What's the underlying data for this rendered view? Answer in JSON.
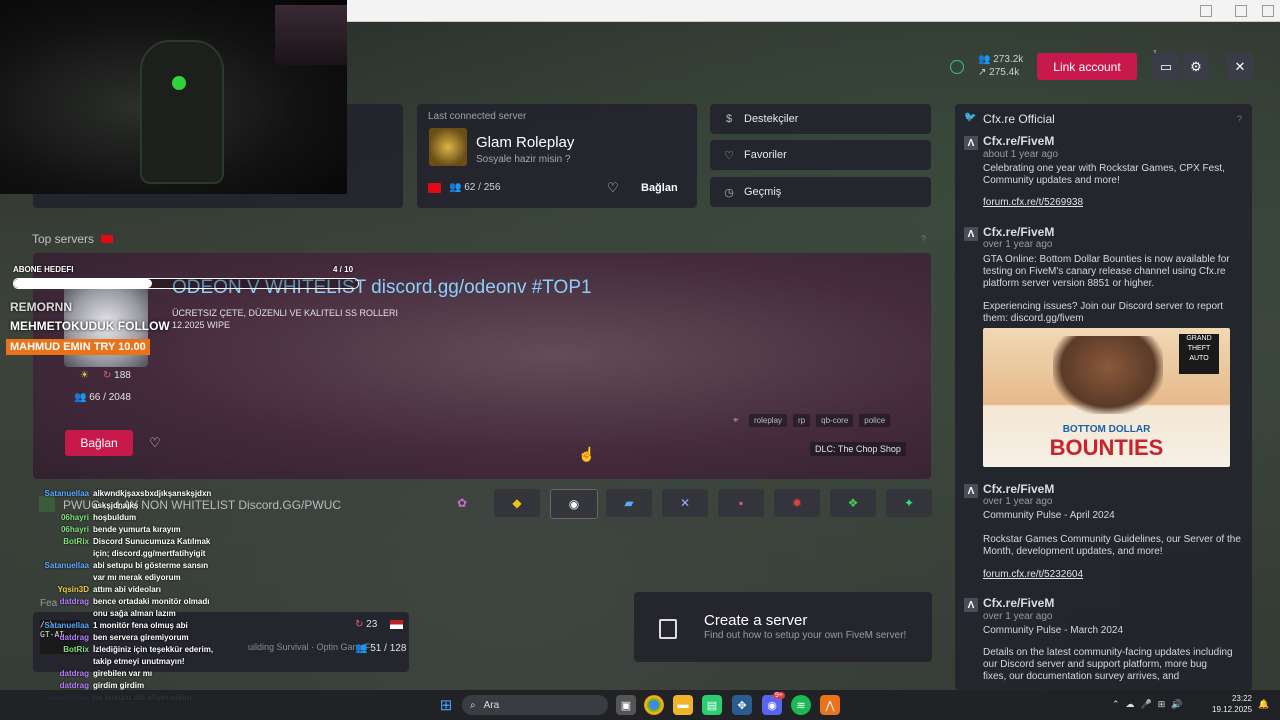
{
  "header": {
    "players_now": "273.2k",
    "players_peak": "275.4k",
    "link_account": "Link account",
    "badge_count": "1"
  },
  "last_server": {
    "heading": "Last connected server",
    "name": "Glam Roleplay",
    "desc": "Sosyale hazir misin ?",
    "players": "62 / 256",
    "connect": "Bağlan"
  },
  "side_menu": {
    "items": [
      {
        "icon": "$",
        "label": "Destekçiler"
      },
      {
        "icon": "♡",
        "label": "Favoriler"
      },
      {
        "icon": "◷",
        "label": "Geçmiş"
      }
    ]
  },
  "top_servers": {
    "label": "Top servers",
    "question": "?"
  },
  "featured": {
    "title": "ODEON V WHITELIST discord.gg/odeonv #TOP1",
    "line1": "ÜCRETSIZ ÇETE, DÜZENLI VE KALITELI SS ROLLERI",
    "line2": "12.2025 WIPE",
    "boosts": "188",
    "players": "66 / 2048",
    "connect": "Bağlan",
    "tags": [
      "roleplay",
      "rp",
      "qb-core",
      "police"
    ],
    "dlc": "DLC: The Chop Shop"
  },
  "overlay": {
    "goal_label": "ABONE HEDEFI",
    "goal_progress": "4 / 10",
    "goal_fraction": 0.4,
    "name1": "REMORNN",
    "name2": "MEHMETOKUDUK FOLLOW",
    "donation": "MAHMUD EMIN  TRY 10.00"
  },
  "server_row2": {
    "text": "PWUC ... LAY NON WHITELIST Discord.GG/PWUC"
  },
  "featured_section": {
    "label": "Fea",
    "server_text": "uilding Survival · Optin Gang F",
    "boosts": "23",
    "players": "51 / 128"
  },
  "create_server": {
    "title": "Create a server",
    "subtitle": "Find out how to setup your own FiveM server!"
  },
  "news": {
    "title": "Cfx.re Official",
    "question": "?",
    "posts": [
      {
        "author": "Cfx.re/FiveM",
        "time": "about 1 year ago",
        "body": "Celebrating one year with Rockstar Games, CPX Fest, Community updates and more!",
        "link": "forum.cfx.re/t/5269938"
      },
      {
        "author": "Cfx.re/FiveM",
        "time": "over 1 year ago",
        "body": "GTA Online: Bottom Dollar Bounties is now available for testing on FiveM's canary release channel using Cfx.re platform server version 8851 or higher.",
        "body2": "Experiencing issues? Join our Discord server to report them: discord.gg/fivem",
        "image_text1": "BOTTOM DOLLAR",
        "image_text2": "BOUNTIES"
      },
      {
        "author": "Cfx.re/FiveM",
        "time": "over 1 year ago",
        "headline": "Community Pulse - April 2024",
        "body": "Rockstar Games Community Guidelines, our Server of the Month, development updates, and more!",
        "link": "forum.cfx.re/t/5232604"
      },
      {
        "author": "Cfx.re/FiveM",
        "time": "over 1 year ago",
        "headline": "Community Pulse - March 2024",
        "body": "Details on the latest community-facing updates including our Discord server and support platform, more bug fixes, our documentation survey arrives, and"
      }
    ]
  },
  "chat": [
    {
      "user": "Satanuellaa",
      "color": "#5aa9ff",
      "msg": "alkwndkjşaxsbxdjıkşanskşjdxn"
    },
    {
      "user": "",
      "color": "#5aa9ff",
      "msg": "askşjdnajkş"
    },
    {
      "user": "06hayri",
      "color": "#7fe07f",
      "msg": "hoşbuldum"
    },
    {
      "user": "06hayri",
      "color": "#7fe07f",
      "msg": "bende yumurta kırayım"
    },
    {
      "user": "BotRix",
      "color": "#7fe07f",
      "msg": "Discord Sunucumuza Katılmak"
    },
    {
      "user": "",
      "color": "#7fe07f",
      "msg": "için; discord.gg/mertfatihyigit"
    },
    {
      "user": "Satanuellaa",
      "color": "#5aa9ff",
      "msg": "abi setupu bi gösterme sansın"
    },
    {
      "user": "",
      "color": "#5aa9ff",
      "msg": "var mı merak ediyorum"
    },
    {
      "user": "Yqsin3D",
      "color": "#f0c94a",
      "msg": "attım abi videoları"
    },
    {
      "user": "datdrag",
      "color": "#b77cff",
      "msg": "bence ortadaki monitör olmadı"
    },
    {
      "user": "",
      "color": "#b77cff",
      "msg": "onu sağa alman lazım"
    },
    {
      "user": "Satanuellaa",
      "color": "#5aa9ff",
      "msg": "1 monitör fena olmuş abi"
    },
    {
      "user": "datdrag",
      "color": "#b77cff",
      "msg": "ben servera giremiyorum"
    },
    {
      "user": "BotRix",
      "color": "#7fe07f",
      "msg": "İzlediğiniz için teşekkür ederim,"
    },
    {
      "user": "",
      "color": "#7fe07f",
      "msg": "takip etmeyi unutmayın!"
    },
    {
      "user": "datdrag",
      "color": "#b77cff",
      "msg": "girebilen var mı"
    },
    {
      "user": "datdrag",
      "color": "#b77cff",
      "msg": "girdim girdim"
    },
    {
      "user": "Satanuellaa",
      "color": "#5aa9ff",
      "msg": "ne kusuru abi afiyet olsun"
    }
  ],
  "taskbar": {
    "search_placeholder": "Ara",
    "time": "23:22",
    "date": "19.12.2025",
    "discord_badge": "9+"
  },
  "colors": {
    "accent": "#c8194b",
    "panel": "#22242c"
  }
}
